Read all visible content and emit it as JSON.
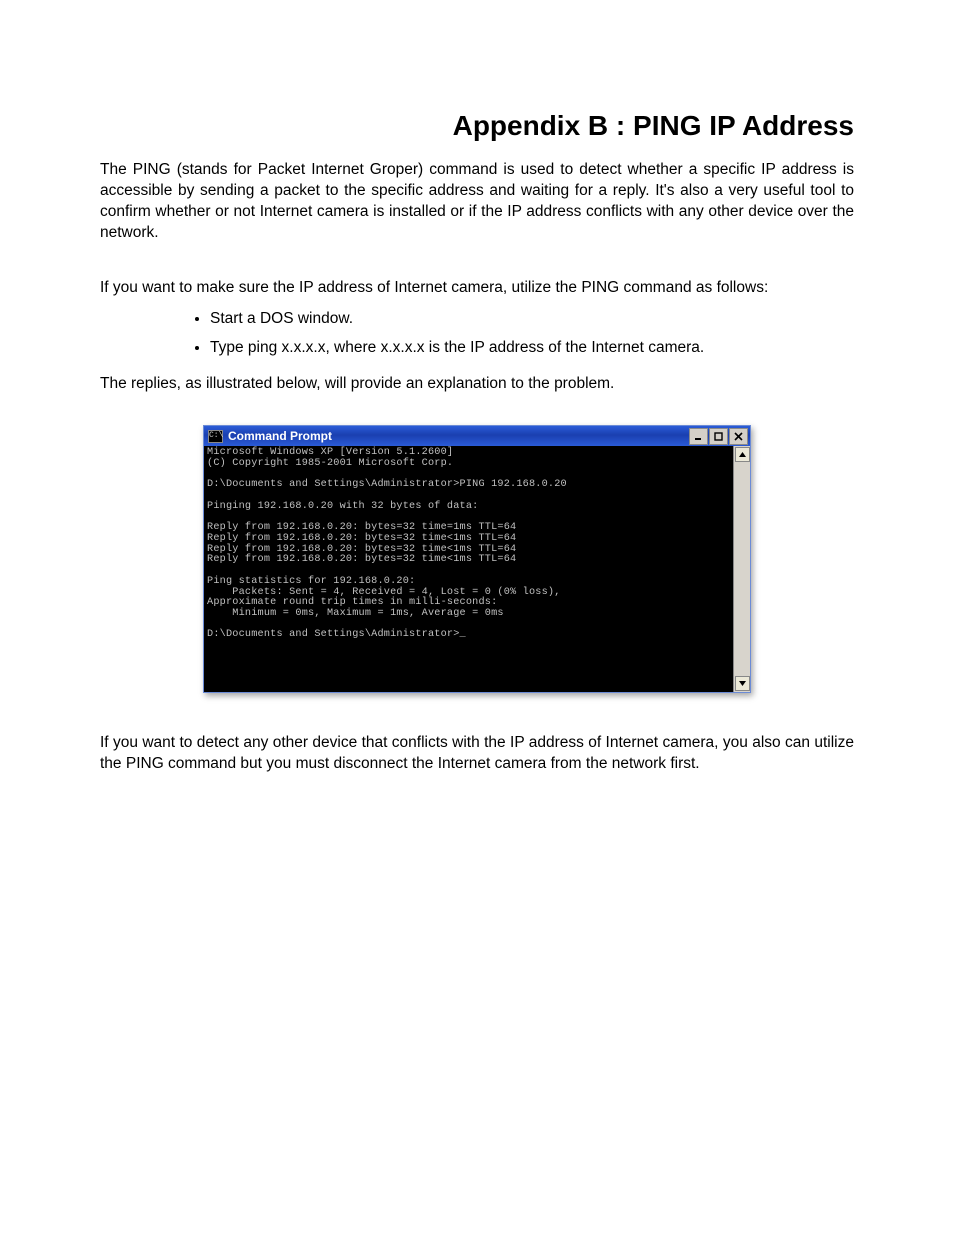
{
  "title": "Appendix B : PING IP Address",
  "para1": "The PING (stands for Packet Internet Groper) command is used to detect whether a specific IP address is accessible by sending a packet to the specific address and waiting for a reply. It's also a very useful tool to confirm whether or not Internet camera is installed or if the IP address conflicts with any other device over the network.",
  "para2": "If you want to make sure the IP address of Internet camera, utilize the PING command as follows:",
  "bullets": [
    "Start a DOS window.",
    "Type ping x.x.x.x, where x.x.x.x is the IP address of the Internet camera."
  ],
  "para3": "The replies, as illustrated below, will provide an explanation to the problem.",
  "cmd": {
    "title": "Command Prompt",
    "icon_glyph": "C:\\",
    "lines": "Microsoft Windows XP [Version 5.1.2600]\n(C) Copyright 1985-2001 Microsoft Corp.\n\nD:\\Documents and Settings\\Administrator>PING 192.168.0.20\n\nPinging 192.168.0.20 with 32 bytes of data:\n\nReply from 192.168.0.20: bytes=32 time=1ms TTL=64\nReply from 192.168.0.20: bytes=32 time<1ms TTL=64\nReply from 192.168.0.20: bytes=32 time<1ms TTL=64\nReply from 192.168.0.20: bytes=32 time<1ms TTL=64\n\nPing statistics for 192.168.0.20:\n    Packets: Sent = 4, Received = 4, Lost = 0 (0% loss),\nApproximate round trip times in milli-seconds:\n    Minimum = 0ms, Maximum = 1ms, Average = 0ms\n\nD:\\Documents and Settings\\Administrator>_"
  },
  "para4": "If you want to detect any other device that conflicts with the IP address of Internet camera,  you also can utilize the PING command but you must disconnect the Internet camera from the network first."
}
